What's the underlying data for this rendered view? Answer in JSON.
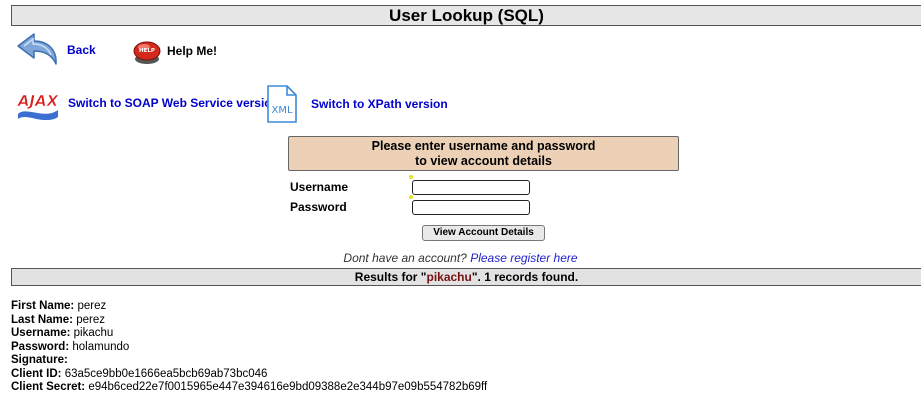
{
  "page": {
    "title": "User Lookup (SQL)"
  },
  "nav": {
    "back_label": "Back",
    "help_label": "Help Me!",
    "help_badge": "HELP",
    "soap_label": "Switch to SOAP Web Service version",
    "soap_icon_text": "AJAX",
    "xpath_label": "Switch to XPath version",
    "xpath_icon_text": "XML"
  },
  "form": {
    "heading_line1": "Please enter username and password",
    "heading_line2": "to view account details",
    "username_label": "Username",
    "username_value": "",
    "password_label": "Password",
    "password_value": "",
    "submit_label": "View Account Details",
    "register_prompt": "Dont have an account? ",
    "register_link": "Please register here"
  },
  "results": {
    "prefix": "Results for \"",
    "query": "pikachu",
    "suffix": "\". 1 records found.",
    "record": [
      {
        "label": "First Name:",
        "value": "perez"
      },
      {
        "label": "Last Name:",
        "value": "perez"
      },
      {
        "label": "Username:",
        "value": "pikachu"
      },
      {
        "label": "Password:",
        "value": "holamundo"
      },
      {
        "label": "Signature:",
        "value": ""
      },
      {
        "label": "Client ID:",
        "value": "63a5ce9bb0e1666ea5bcb69ab73bc046"
      },
      {
        "label": "Client Secret:",
        "value": "e94b6ced22e7f0015965e447e394616e9bd09388e2e344b97e09b554782b69ff"
      }
    ]
  },
  "colors": {
    "title_bg": "#e6e6e6",
    "panel_bg": "#ecd1b7",
    "link": "#0000cc",
    "query_highlight": "#771111"
  }
}
